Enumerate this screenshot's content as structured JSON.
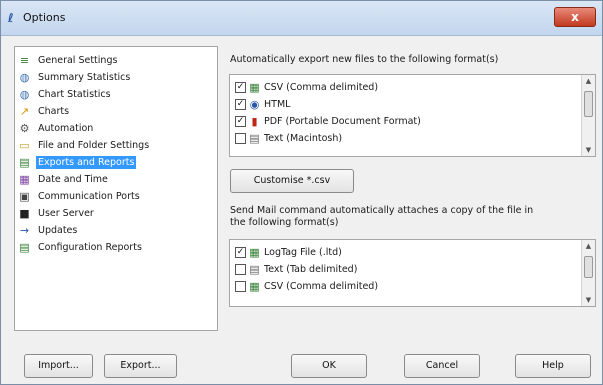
{
  "window": {
    "title": "Options",
    "close_label": "x"
  },
  "tree": {
    "items": [
      {
        "label": "General Settings",
        "icon": "≡",
        "icon_color": "#2f7d2f"
      },
      {
        "label": "Summary Statistics",
        "icon": "◍",
        "icon_color": "#3a6fb0"
      },
      {
        "label": "Chart Statistics",
        "icon": "◍",
        "icon_color": "#3a6fb0"
      },
      {
        "label": "Charts",
        "icon": "↗",
        "icon_color": "#d69500"
      },
      {
        "label": "Automation",
        "icon": "⚙",
        "icon_color": "#555"
      },
      {
        "label": "File and Folder Settings",
        "icon": "▭",
        "icon_color": "#c9a233"
      },
      {
        "label": "Exports and Reports",
        "icon": "▤",
        "icon_color": "#2f7d2f"
      },
      {
        "label": "Date and Time",
        "icon": "▦",
        "icon_color": "#7a3fa0"
      },
      {
        "label": "Communication Ports",
        "icon": "▣",
        "icon_color": "#444"
      },
      {
        "label": "User Server",
        "icon": "■",
        "icon_color": "#222"
      },
      {
        "label": "Updates",
        "icon": "→",
        "icon_color": "#2b57a8"
      },
      {
        "label": "Configuration Reports",
        "icon": "▤",
        "icon_color": "#2f7d2f"
      }
    ],
    "selected_index": 6
  },
  "export_section": {
    "label": "Automatically export new files to the following format(s)",
    "items": [
      {
        "label": "CSV (Comma delimited)",
        "checked": true,
        "icon": "▦",
        "icon_color": "#2f7d2f"
      },
      {
        "label": "HTML",
        "checked": true,
        "icon": "◉",
        "icon_color": "#2b57a8"
      },
      {
        "label": "PDF (Portable Document Format)",
        "checked": true,
        "icon": "▮",
        "icon_color": "#c0271b"
      },
      {
        "label": "Text (Macintosh)",
        "checked": false,
        "icon": "▤",
        "icon_color": "#666"
      }
    ],
    "customise_button": "Customise *.csv"
  },
  "mail_section": {
    "label_line1": "Send Mail command automatically attaches a copy of the file in",
    "label_line2": "the following format(s)",
    "items": [
      {
        "label": "LogTag File (.ltd)",
        "checked": true,
        "icon": "▦",
        "icon_color": "#2f7d2f"
      },
      {
        "label": "Text (Tab delimited)",
        "checked": false,
        "icon": "▤",
        "icon_color": "#666"
      },
      {
        "label": "CSV (Comma delimited)",
        "checked": false,
        "icon": "▦",
        "icon_color": "#2f7d2f"
      }
    ]
  },
  "buttons": {
    "import": "Import...",
    "export": "Export...",
    "ok": "OK",
    "cancel": "Cancel",
    "help": "Help"
  }
}
